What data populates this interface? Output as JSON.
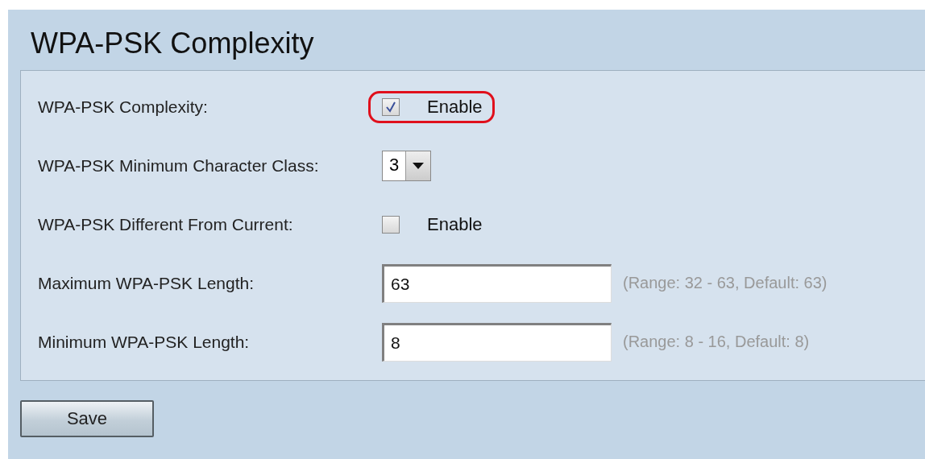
{
  "title": "WPA-PSK Complexity",
  "rows": [
    {
      "kind": "checkbox",
      "label": "WPA-PSK Complexity:",
      "checked": true,
      "option": "Enable",
      "highlighted": true
    },
    {
      "kind": "select",
      "label": "WPA-PSK Minimum Character Class:",
      "value": "3",
      "highlighted": false
    },
    {
      "kind": "checkbox",
      "label": "WPA-PSK Different From Current:",
      "checked": false,
      "option": "Enable",
      "highlighted": false
    },
    {
      "kind": "text",
      "label": "Maximum WPA-PSK Length:",
      "value": "63",
      "hint": "(Range: 32 - 63, Default: 63)",
      "highlighted": false
    },
    {
      "kind": "text",
      "label": "Minimum WPA-PSK Length:",
      "value": "8",
      "hint": "(Range: 8 - 16, Default: 8)",
      "highlighted": false
    }
  ],
  "save_button": "Save"
}
